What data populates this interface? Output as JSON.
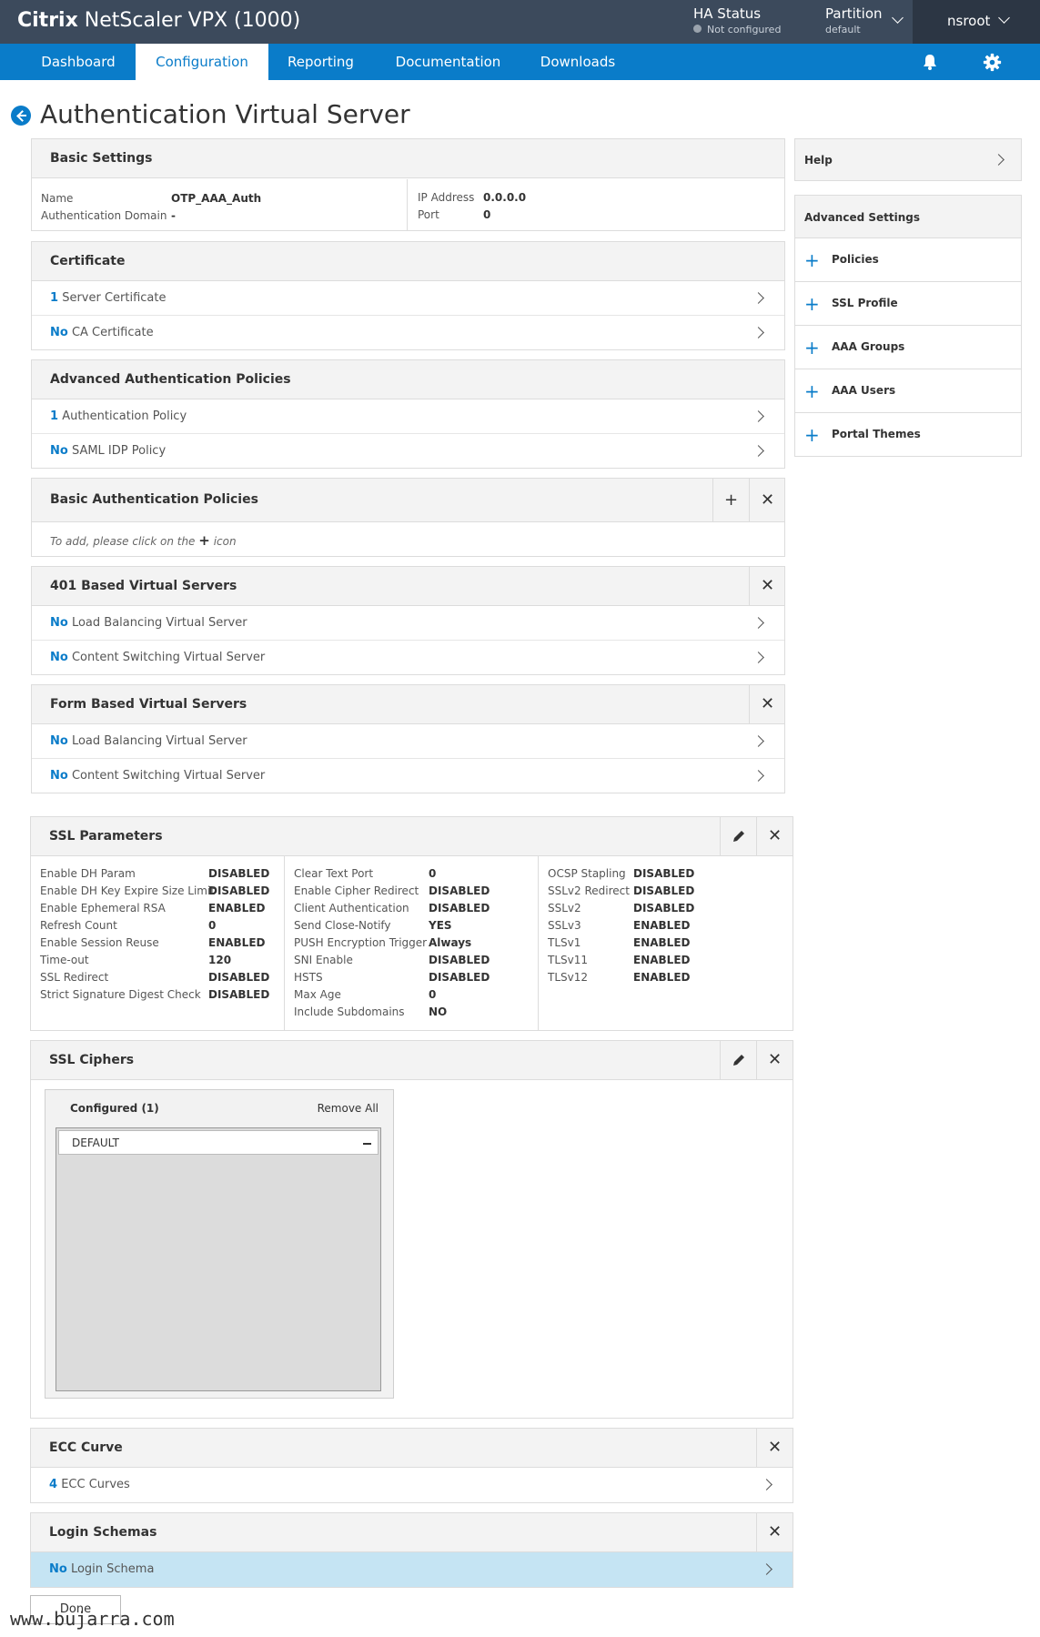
{
  "header": {
    "brand_bold": "Citrix",
    "brand_rest": "NetScaler VPX (1000)",
    "ha_title": "HA Status",
    "ha_status": "Not configured",
    "partition_title": "Partition",
    "partition_value": "default",
    "user": "nsroot"
  },
  "nav": {
    "tabs": [
      "Dashboard",
      "Configuration",
      "Reporting",
      "Documentation",
      "Downloads"
    ],
    "active": "Configuration"
  },
  "page_title": "Authentication Virtual Server",
  "basic_settings": {
    "title": "Basic Settings",
    "name_label": "Name",
    "name_value": "OTP_AAA_Auth",
    "domain_label": "Authentication Domain",
    "domain_value": "-",
    "ip_label": "IP Address",
    "ip_value": "0.0.0.0",
    "port_label": "Port",
    "port_value": "0"
  },
  "certificate": {
    "title": "Certificate",
    "rows": [
      {
        "count": "1",
        "label": "Server Certificate"
      },
      {
        "count": "No",
        "label": "CA Certificate"
      }
    ]
  },
  "advanced_auth": {
    "title": "Advanced Authentication Policies",
    "rows": [
      {
        "count": "1",
        "label": "Authentication Policy"
      },
      {
        "count": "No",
        "label": "SAML IDP Policy"
      }
    ]
  },
  "basic_auth": {
    "title": "Basic Authentication Policies",
    "hint_before": "To add, please click on the",
    "hint_after": "icon"
  },
  "vs_401": {
    "title": "401 Based Virtual Servers",
    "rows": [
      {
        "count": "No",
        "label": "Load Balancing Virtual Server"
      },
      {
        "count": "No",
        "label": "Content Switching Virtual Server"
      }
    ]
  },
  "vs_form": {
    "title": "Form Based Virtual Servers",
    "rows": [
      {
        "count": "No",
        "label": "Load Balancing Virtual Server"
      },
      {
        "count": "No",
        "label": "Content Switching Virtual Server"
      }
    ]
  },
  "ssl_params": {
    "title": "SSL Parameters",
    "col1": [
      {
        "k": "Enable DH Param",
        "v": "DISABLED"
      },
      {
        "k": "Enable DH Key Expire Size Limit",
        "v": "DISABLED"
      },
      {
        "k": "Enable Ephemeral RSA",
        "v": "ENABLED"
      },
      {
        "k": "Refresh Count",
        "v": "0"
      },
      {
        "k": "Enable Session Reuse",
        "v": "ENABLED"
      },
      {
        "k": "Time-out",
        "v": "120"
      },
      {
        "k": "SSL Redirect",
        "v": "DISABLED"
      },
      {
        "k": "Strict Signature Digest Check",
        "v": "DISABLED"
      }
    ],
    "col2": [
      {
        "k": "Clear Text Port",
        "v": "0"
      },
      {
        "k": "Enable Cipher Redirect",
        "v": "DISABLED"
      },
      {
        "k": "Client Authentication",
        "v": "DISABLED"
      },
      {
        "k": "Send Close-Notify",
        "v": "YES"
      },
      {
        "k": "PUSH Encryption Trigger",
        "v": "Always"
      },
      {
        "k": "SNI Enable",
        "v": "DISABLED"
      },
      {
        "k": "HSTS",
        "v": "DISABLED"
      },
      {
        "k": "Max Age",
        "v": "0"
      },
      {
        "k": "Include Subdomains",
        "v": "NO"
      }
    ],
    "col3": [
      {
        "k": "OCSP Stapling",
        "v": "DISABLED"
      },
      {
        "k": "SSLv2 Redirect",
        "v": "DISABLED"
      },
      {
        "k": "SSLv2",
        "v": "DISABLED"
      },
      {
        "k": "SSLv3",
        "v": "ENABLED"
      },
      {
        "k": "TLSv1",
        "v": "ENABLED"
      },
      {
        "k": "TLSv11",
        "v": "ENABLED"
      },
      {
        "k": "TLSv12",
        "v": "ENABLED"
      }
    ]
  },
  "ssl_ciphers": {
    "title": "SSL Ciphers",
    "configured_label": "Configured (1)",
    "remove_all": "Remove All",
    "items": [
      "DEFAULT"
    ]
  },
  "ecc": {
    "title": "ECC Curve",
    "count": "4",
    "label": "ECC Curves"
  },
  "login": {
    "title": "Login Schemas",
    "count": "No",
    "label": "Login Schema"
  },
  "sidebar": {
    "help": "Help",
    "advanced_title": "Advanced Settings",
    "items": [
      "Policies",
      "SSL Profile",
      "AAA Groups",
      "AAA Users",
      "Portal Themes"
    ]
  },
  "done_label": "Done",
  "watermark": "www.bujarra.com",
  "colors": {
    "accent": "#0a7cc9",
    "topbar": "#3c4a5c",
    "highlight_row": "#c5e4f3"
  }
}
